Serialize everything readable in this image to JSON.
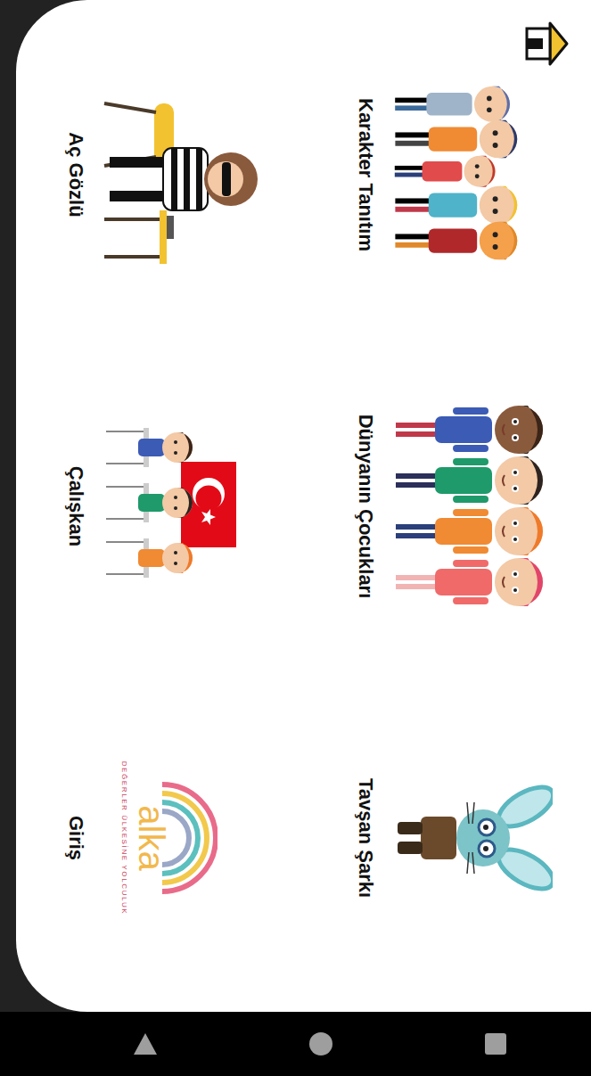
{
  "cards": [
    {
      "title": "Karakter Tanıtım",
      "kind": "characters"
    },
    {
      "title": "Dünyanın Çocukları",
      "kind": "kids"
    },
    {
      "title": "Tavşan Şarkı",
      "kind": "rabbit"
    },
    {
      "title": "Aç Gözlü",
      "kind": "thief"
    },
    {
      "title": "Çalışkan",
      "kind": "classroom"
    },
    {
      "title": "Giriş",
      "kind": "logo",
      "logo": {
        "name": "alka",
        "tagline": "DEĞERLER ÜLKESİNE YOLCULUK"
      }
    }
  ]
}
